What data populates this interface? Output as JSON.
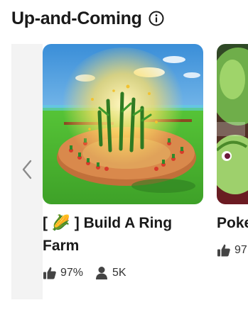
{
  "section": {
    "title": "Up-and-Coming",
    "info_icon": "info-circle-icon"
  },
  "carousel": {
    "prev_icon": "chevron-left-icon"
  },
  "games": [
    {
      "name": "[ 🌽 ] Build A Ring Farm",
      "rating": "97%",
      "players": "5K",
      "rating_icon": "thumbs-up-icon",
      "players_icon": "person-icon"
    },
    {
      "name": "Poke Bron",
      "rating": "97",
      "rating_icon": "thumbs-up-icon"
    }
  ]
}
